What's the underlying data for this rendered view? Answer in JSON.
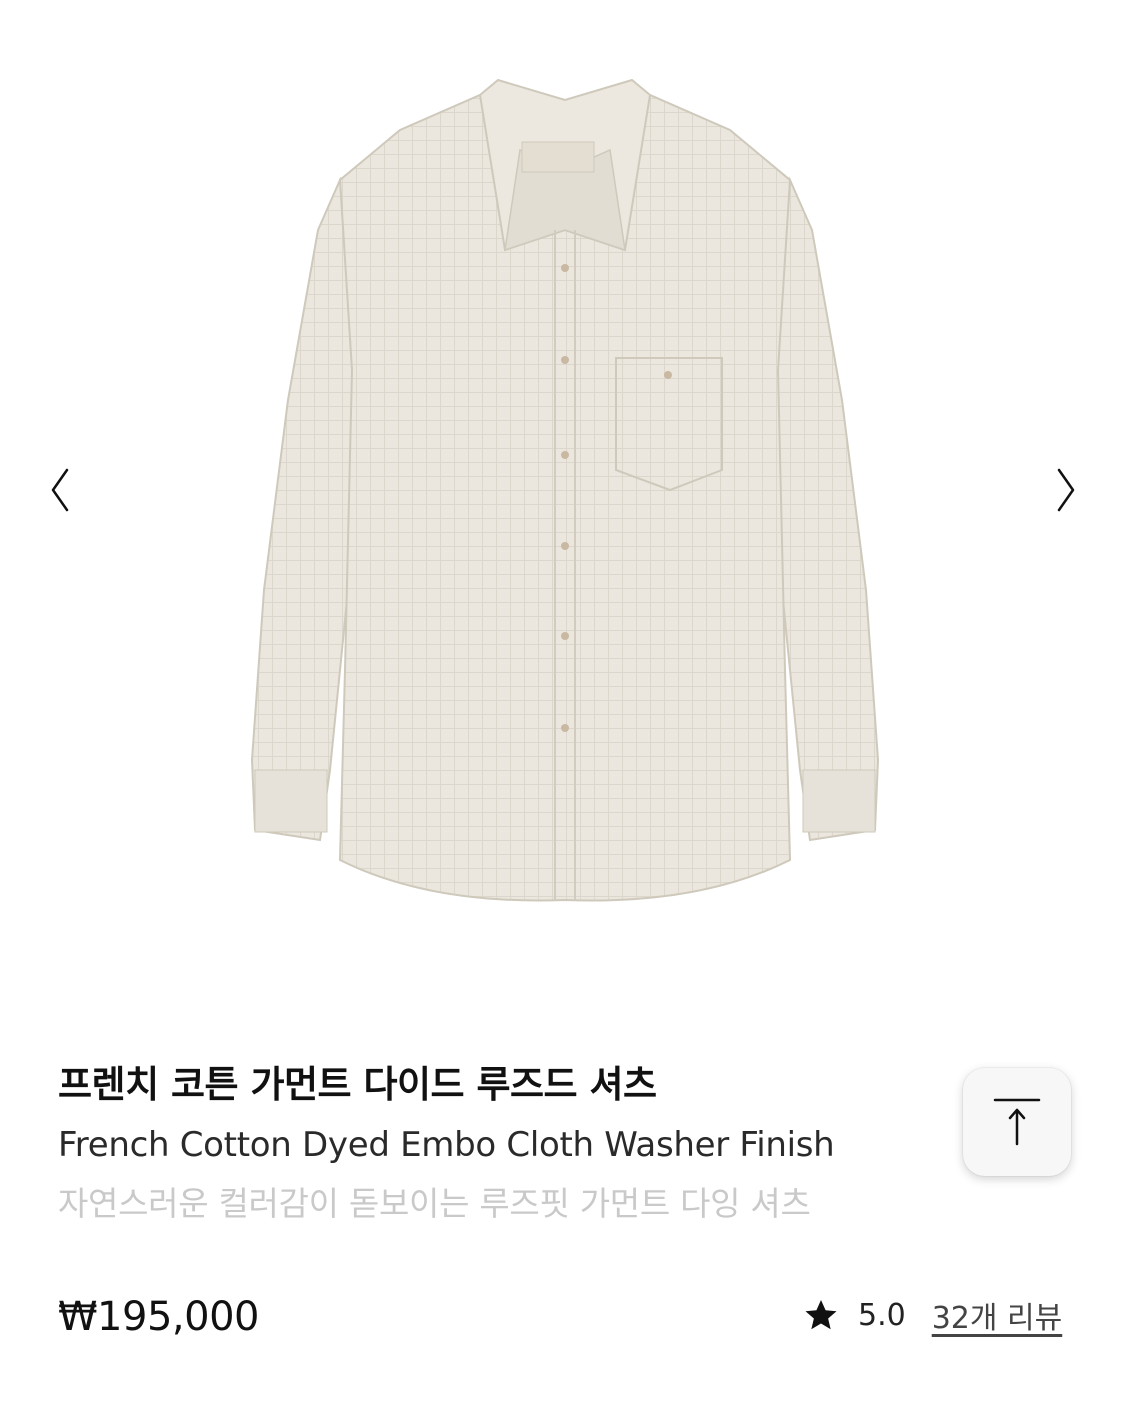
{
  "product": {
    "image_alt": "French Cotton Dyed Embo Cloth Washer Finish shirt",
    "title_ko": "프렌치 코튼 가먼트 다이드 루즈드 셔츠",
    "title_en": "French Cotton Dyed Embo Cloth Washer Finish",
    "subtitle": "자연스러운 컬러감이 돋보이는 루즈핏 가먼트 다잉 셔츠",
    "price": "₩195,000",
    "rating": "5.0",
    "review_link": "32개 리뷰"
  },
  "icons": {
    "prev": "chevron-left-icon",
    "next": "chevron-right-icon",
    "scroll_top": "arrow-up-to-line-icon",
    "rating": "star-icon"
  },
  "colors": {
    "shirt": "#e9e5dc",
    "shirt_shadow": "#d6d1c6",
    "text_primary": "#111111",
    "text_muted": "#c9c9c9",
    "button_bg": "#f7f7f7"
  }
}
